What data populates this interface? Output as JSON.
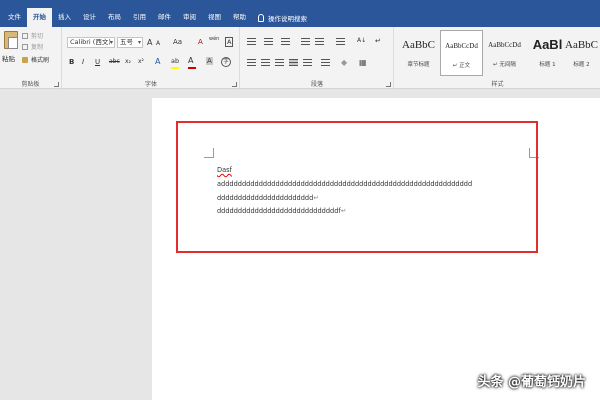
{
  "ribbon_tabs": {
    "file": "文件",
    "home": "开始",
    "insert": "插入",
    "design": "设计",
    "layout": "布局",
    "references": "引用",
    "mailings": "邮件",
    "review": "审阅",
    "view": "视图",
    "help": "帮助",
    "tell_me": "操作说明搜索"
  },
  "clipboard": {
    "paste": "粘贴",
    "cut": "剪切",
    "copy": "复制",
    "format_painter": "格式刷",
    "label": "剪贴板"
  },
  "font": {
    "font_name": "Calibri (西文)",
    "font_size": "五号",
    "grow": "A",
    "shrink": "A",
    "change_case": "Aa",
    "clear_format": "A",
    "phonetic": "wén",
    "char_border": "A",
    "bold": "B",
    "italic": "I",
    "underline": "U",
    "strike": "abc",
    "subscript": "x₂",
    "superscript": "x²",
    "text_effects": "A",
    "highlight": "ab",
    "font_color": "A",
    "char_shading": "A",
    "enclose": "字",
    "label": "字体"
  },
  "paragraph": {
    "sort": "A↓",
    "show_marks": "↵",
    "label": "段落"
  },
  "styles": {
    "items": [
      {
        "sample": "AaBbC",
        "name": "章节标题"
      },
      {
        "sample": "AaBbCcDd",
        "name": "↵ 正文"
      },
      {
        "sample": "AaBbCcDd",
        "name": "↵ 无间隔"
      },
      {
        "sample": "AaBl",
        "name": "标题 1"
      },
      {
        "sample": "AaBbC",
        "name": "标题 2"
      }
    ],
    "label": "样式"
  },
  "document": {
    "line1": "Dasf",
    "line2": "adddddddddddddddddddddddddddddddddddddddddddddddddddddddddddd",
    "line3": "ddddddddddddddddddddddd",
    "line4": "dddddddddddddddddddddddddddddf",
    "para_mark": "↵"
  },
  "watermark": "头条 @葡萄钙奶片",
  "colors": {
    "accent": "#2b579a",
    "highlight_box": "#e32d2d"
  }
}
